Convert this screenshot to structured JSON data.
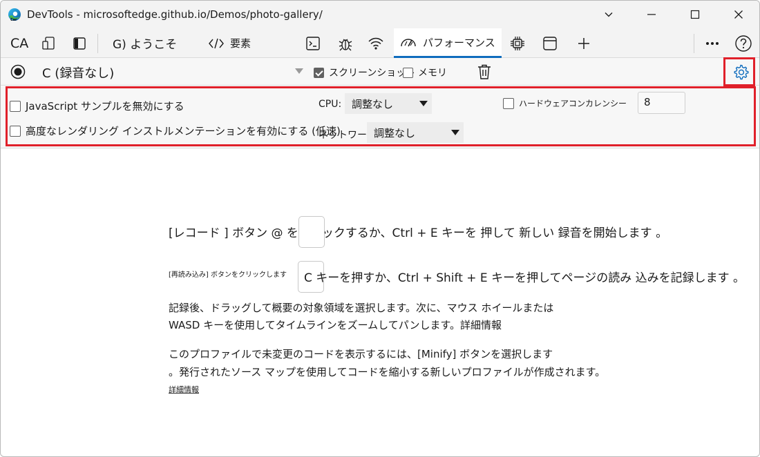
{
  "window": {
    "title": "DevTools - microsoftedge.github.io/Demos/photo-gallery/"
  },
  "tabs": {
    "device_label": "CA",
    "welcome": "G) ようこそ",
    "elements": "要素",
    "performance": "パフォーマンス"
  },
  "toolbar": {
    "recording_select": "C (録音なし)",
    "screenshots_label": "スクリーンショット",
    "screenshots_checked": true,
    "memory_label": "メモリ",
    "memory_checked": false
  },
  "settings": {
    "disable_js_samples": "JavaScript サンプルを無効にする",
    "advanced_rendering": "高度なレンダリング インストルメンテーションを有効にする (低速)",
    "cpu_label": "CPU:",
    "cpu_value": "調整なし",
    "network_label": "ネットワーク:",
    "network_value": "調整なし",
    "hw_concurrency_label": "ハードウェアコンカレンシー",
    "hw_concurrency_value": "8"
  },
  "main": {
    "line1_a": "[レコード ] ボタン @ をクリックするか、Ctrl + E キーを 押して 新しい 録音を開始します 。",
    "line2_small": "[再読み込み] ボタンをクリックします",
    "line2_b": "C キーを押すか、Ctrl + Shift + E キーを押してページの読み 込みを記録します 。",
    "line3": "記録後、ドラッグして概要の対象領域を選択します。次に、マウス ホイールまたは",
    "line4": "WASD キーを使用してタイムラインをズームしてパンします。詳細情報",
    "line5": "このプロファイルで未変更のコードを表示するには、[Minify] ボタンを選択します",
    "line6": "。発行されたソース マップを使用してコードを縮小する新しいプロファイルが作成されます。",
    "learn_more": "詳細情報"
  },
  "colors": {
    "accent": "#0f6cbd",
    "highlight": "#e0202a"
  }
}
